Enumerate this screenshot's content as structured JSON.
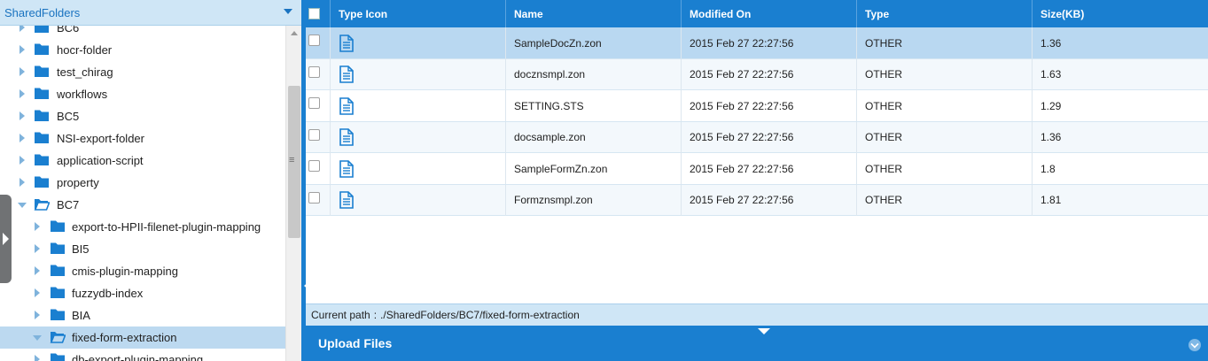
{
  "root_select": {
    "label": "SharedFolders"
  },
  "tree": [
    {
      "label": "BC6",
      "level": 1,
      "expander": "collapsed",
      "folder": "closed"
    },
    {
      "label": "hocr-folder",
      "level": 1,
      "expander": "collapsed",
      "folder": "closed"
    },
    {
      "label": "test_chirag",
      "level": 1,
      "expander": "collapsed",
      "folder": "closed"
    },
    {
      "label": "workflows",
      "level": 1,
      "expander": "collapsed",
      "folder": "closed"
    },
    {
      "label": "BC5",
      "level": 1,
      "expander": "collapsed",
      "folder": "closed"
    },
    {
      "label": "NSI-export-folder",
      "level": 1,
      "expander": "collapsed",
      "folder": "closed"
    },
    {
      "label": "application-script",
      "level": 1,
      "expander": "collapsed",
      "folder": "closed"
    },
    {
      "label": "property",
      "level": 1,
      "expander": "collapsed",
      "folder": "closed"
    },
    {
      "label": "BC7",
      "level": 1,
      "expander": "expanded",
      "folder": "open"
    },
    {
      "label": "export-to-HPII-filenet-plugin-mapping",
      "level": 2,
      "expander": "collapsed",
      "folder": "closed"
    },
    {
      "label": "BI5",
      "level": 2,
      "expander": "collapsed",
      "folder": "closed"
    },
    {
      "label": "cmis-plugin-mapping",
      "level": 2,
      "expander": "collapsed",
      "folder": "closed"
    },
    {
      "label": "fuzzydb-index",
      "level": 2,
      "expander": "collapsed",
      "folder": "closed"
    },
    {
      "label": "BIA",
      "level": 2,
      "expander": "collapsed",
      "folder": "closed"
    },
    {
      "label": "fixed-form-extraction",
      "level": 2,
      "expander": "expanded",
      "folder": "open",
      "selected": true
    },
    {
      "label": "db-export-plugin-mapping",
      "level": 2,
      "expander": "collapsed",
      "folder": "closed"
    }
  ],
  "grid": {
    "columns": [
      "Type Icon",
      "Name",
      "Modified On",
      "Type",
      "Size(KB)"
    ],
    "rows": [
      {
        "name": "SampleDocZn.zon",
        "modified": "2015 Feb 27 22:27:56",
        "type": "OTHER",
        "size": "1.36",
        "selected": true
      },
      {
        "name": "docznsmpl.zon",
        "modified": "2015 Feb 27 22:27:56",
        "type": "OTHER",
        "size": "1.63"
      },
      {
        "name": "SETTING.STS",
        "modified": "2015 Feb 27 22:27:56",
        "type": "OTHER",
        "size": "1.29"
      },
      {
        "name": "docsample.zon",
        "modified": "2015 Feb 27 22:27:56",
        "type": "OTHER",
        "size": "1.36"
      },
      {
        "name": "SampleFormZn.zon",
        "modified": "2015 Feb 27 22:27:56",
        "type": "OTHER",
        "size": "1.8"
      },
      {
        "name": "Formznsmpl.zon",
        "modified": "2015 Feb 27 22:27:56",
        "type": "OTHER",
        "size": "1.81"
      }
    ]
  },
  "path_bar": {
    "label": "Current path",
    "separator": ":",
    "value": "./SharedFolders/BC7/fixed-form-extraction"
  },
  "upload": {
    "label": "Upload Files"
  },
  "colors": {
    "accent": "#1a7fd0",
    "selected_row": "#b9d8f1",
    "path_bar": "#cfe6f6",
    "folder": "#1a7fd0"
  },
  "icons": {
    "file": "document-icon",
    "folder_closed": "folder-icon",
    "folder_open": "folder-open-icon",
    "dropdown": "chevron-down-icon"
  }
}
